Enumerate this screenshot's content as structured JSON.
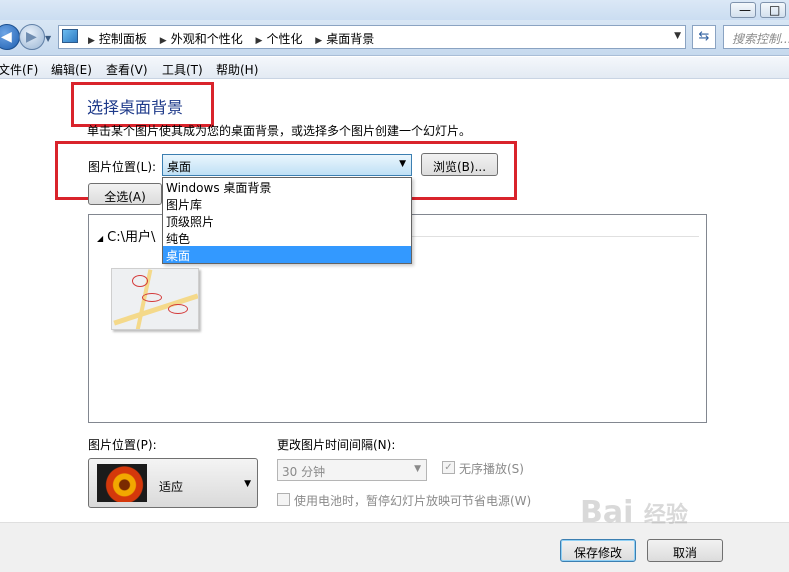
{
  "window": {
    "minimize_glyph": "—",
    "maximize_glyph": "□"
  },
  "nav": {
    "breadcrumb": [
      "控制面板",
      "外观和个性化",
      "个性化",
      "桌面背景"
    ],
    "search_placeholder": "搜索控制..."
  },
  "menu": [
    "文件(F)",
    "编辑(E)",
    "查看(V)",
    "工具(T)",
    "帮助(H)"
  ],
  "page": {
    "heading": "选择桌面背景",
    "description": "单击某个图片使其成为您的桌面背景，或选择多个图片创建一个幻灯片。",
    "location_label": "图片位置(L):",
    "location_value": "桌面",
    "browse_label": "浏览(B)...",
    "select_all_label": "全选(A)",
    "location_options": [
      "Windows 桌面背景",
      "图片库",
      "顶级照片",
      "纯色",
      "桌面"
    ],
    "selected_option": "桌面",
    "folder_label": "C:\\用户\\"
  },
  "options": {
    "position_label": "图片位置(P):",
    "position_value": "适应",
    "interval_label": "更改图片时间间隔(N):",
    "interval_value": "30 分钟",
    "shuffle_label": "无序播放(S)",
    "shuffle_checked": true,
    "battery_label": "使用电池时，暂停幻灯片放映可节省电源(W)",
    "battery_checked": false
  },
  "footer": {
    "save_label": "保存修改",
    "cancel_label": "取消"
  },
  "watermark": {
    "text": "Bai",
    "suffix": "经验"
  },
  "colors": {
    "highlight": "#3399ff",
    "annotation_red": "#d9232b",
    "heading": "#1e3a8a"
  }
}
